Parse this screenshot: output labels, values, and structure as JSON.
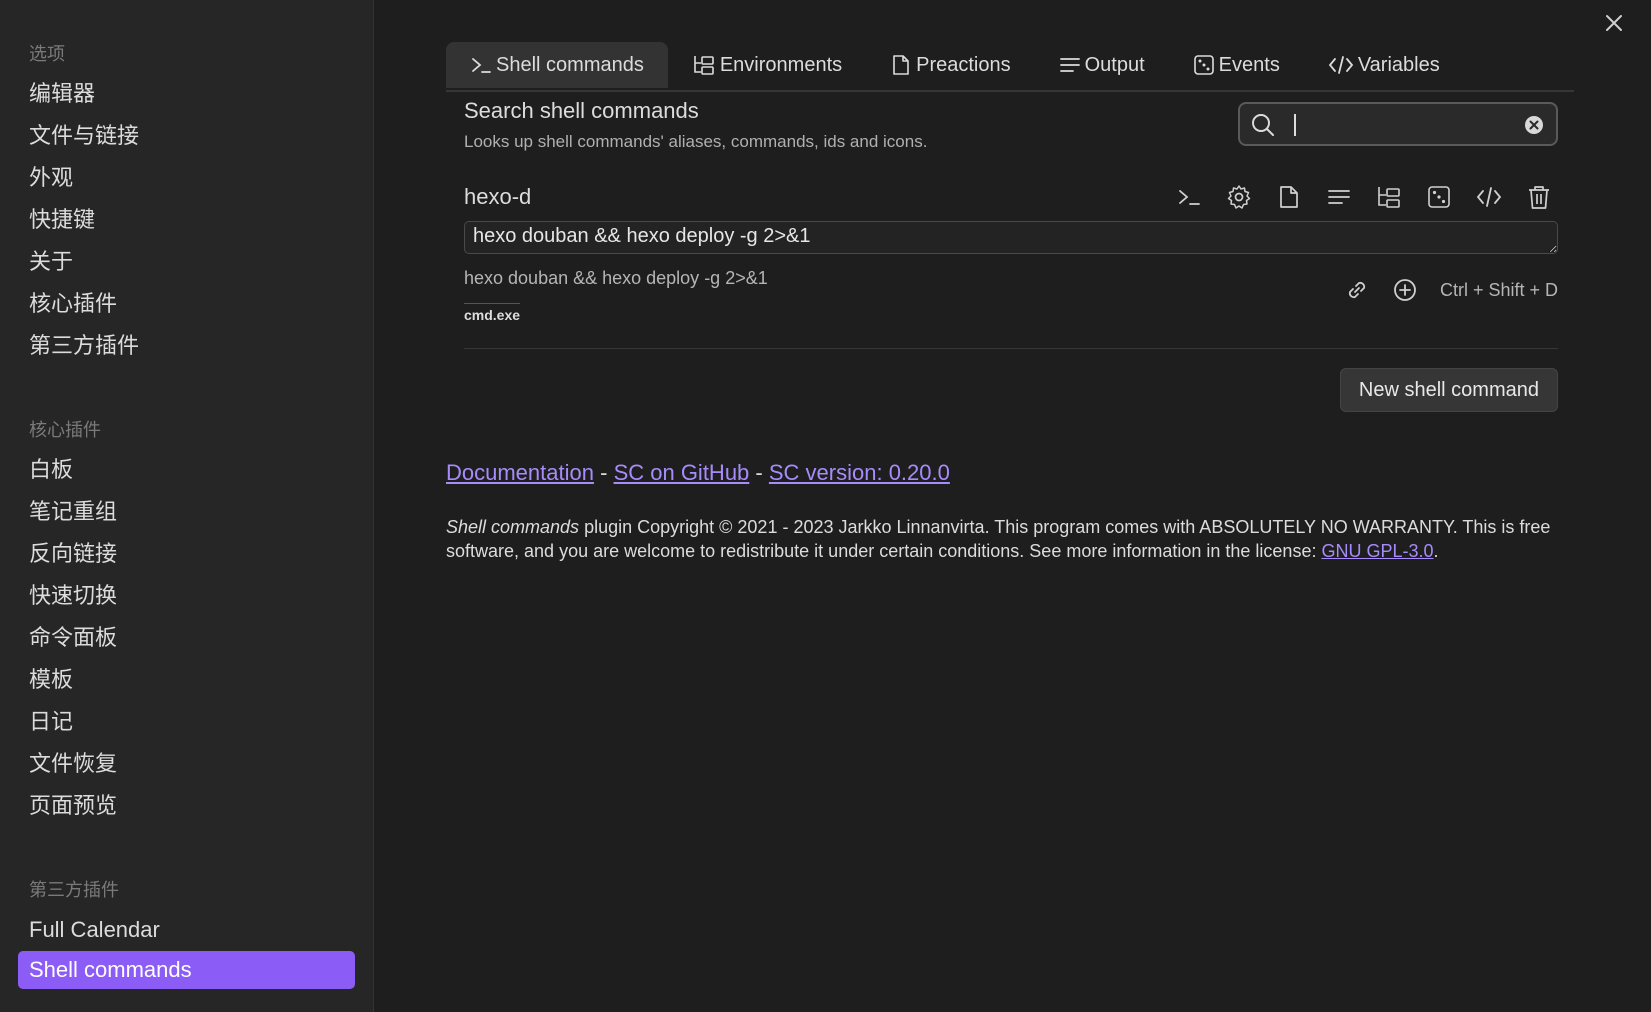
{
  "sidebar": {
    "options_heading": "选项",
    "options_items": [
      "编辑器",
      "文件与链接",
      "外观",
      "快捷键",
      "关于",
      "核心插件",
      "第三方插件"
    ],
    "core_heading": "核心插件",
    "core_items": [
      "白板",
      "笔记重组",
      "反向链接",
      "快速切换",
      "命令面板",
      "模板",
      "日记",
      "文件恢复",
      "页面预览"
    ],
    "third_heading": "第三方插件",
    "third_items": [
      "Full Calendar",
      "Shell commands"
    ]
  },
  "tabs": [
    "Shell commands",
    "Environments",
    "Preactions",
    "Output",
    "Events",
    "Variables"
  ],
  "search": {
    "title": "Search shell commands",
    "description": "Looks up shell commands' aliases, commands, ids and icons.",
    "value": ""
  },
  "command": {
    "alias": "hexo-d",
    "input_value": "hexo douban && hexo deploy -g 2>&1",
    "preview": "hexo douban && hexo deploy -g 2>&1",
    "shell": "cmd.exe",
    "hotkey": "Ctrl + Shift + D"
  },
  "new_button": "New shell command",
  "footer": {
    "doc_link": "Documentation",
    "sep": "-",
    "github_link": "SC on GitHub",
    "version_link": "SC version: 0.20.0",
    "plugin_name": "Shell commands",
    "copyright_text": " plugin Copyright © 2021 - 2023 Jarkko Linnanvirta. This program comes with ABSOLUTELY NO WARRANTY. This is free software, and you are welcome to redistribute it under certain conditions. See more information in the license: ",
    "license_link": "GNU GPL-3.0",
    "period": "."
  },
  "colors": {
    "accent": "#8b5cf6",
    "link": "#a78bfa",
    "background": "#1e1e1e",
    "sidebar": "#262626"
  }
}
